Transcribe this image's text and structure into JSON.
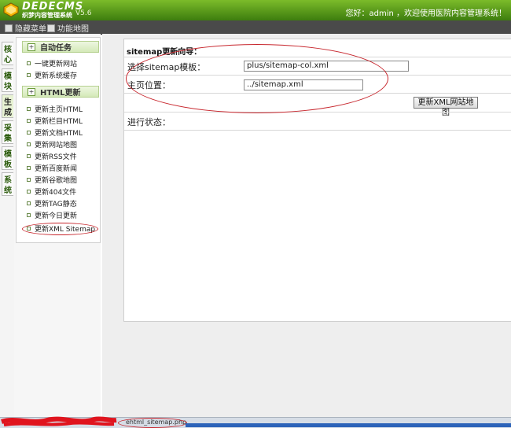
{
  "header": {
    "logo_text": "DEDECMS",
    "logo_subtitle": "织梦内容管理系统",
    "version": "V5.6",
    "welcome": "您好：admin ，欢迎使用医院内容管理系统！"
  },
  "menubar": {
    "hide_menu_label": "隐藏菜单",
    "site_map_label": "功能地图"
  },
  "vertical_tabs": [
    {
      "label": "核心",
      "active": false
    },
    {
      "label": "模块",
      "active": false
    },
    {
      "label": "生成",
      "active": true
    },
    {
      "label": "采集",
      "active": false
    },
    {
      "label": "模板",
      "active": false
    },
    {
      "label": "系统",
      "active": false
    }
  ],
  "left_menu": {
    "group1_title": "自动任务",
    "group1_items": [
      "一键更新网站",
      "更新系统缓存"
    ],
    "group2_title": "HTML更新",
    "group2_items": [
      "更新主页HTML",
      "更新栏目HTML",
      "更新文档HTML",
      "更新网站地图",
      "更新RSS文件",
      "更新百度新闻",
      "更新谷歌地图",
      "更新404文件",
      "更新TAG静态",
      "更新今日更新",
      "更新XML Sitemap"
    ]
  },
  "form": {
    "title": "sitemap更新向导：",
    "template_label": "选择sitemap模板：",
    "template_value": "plus/sitemap-col.xml",
    "homepage_label": "主页位置：",
    "homepage_value": "../sitemap.xml",
    "submit_label": "更新XML网站地图",
    "status_label": "进行状态："
  },
  "statusbar": {
    "text": "ehtml_sitemap.php"
  },
  "colors": {
    "header_green": "#5a9a1e",
    "menubar_bg": "#4a4a4a",
    "annotation_red": "#c7252c",
    "taskbar_blue": "#2c63b9"
  }
}
